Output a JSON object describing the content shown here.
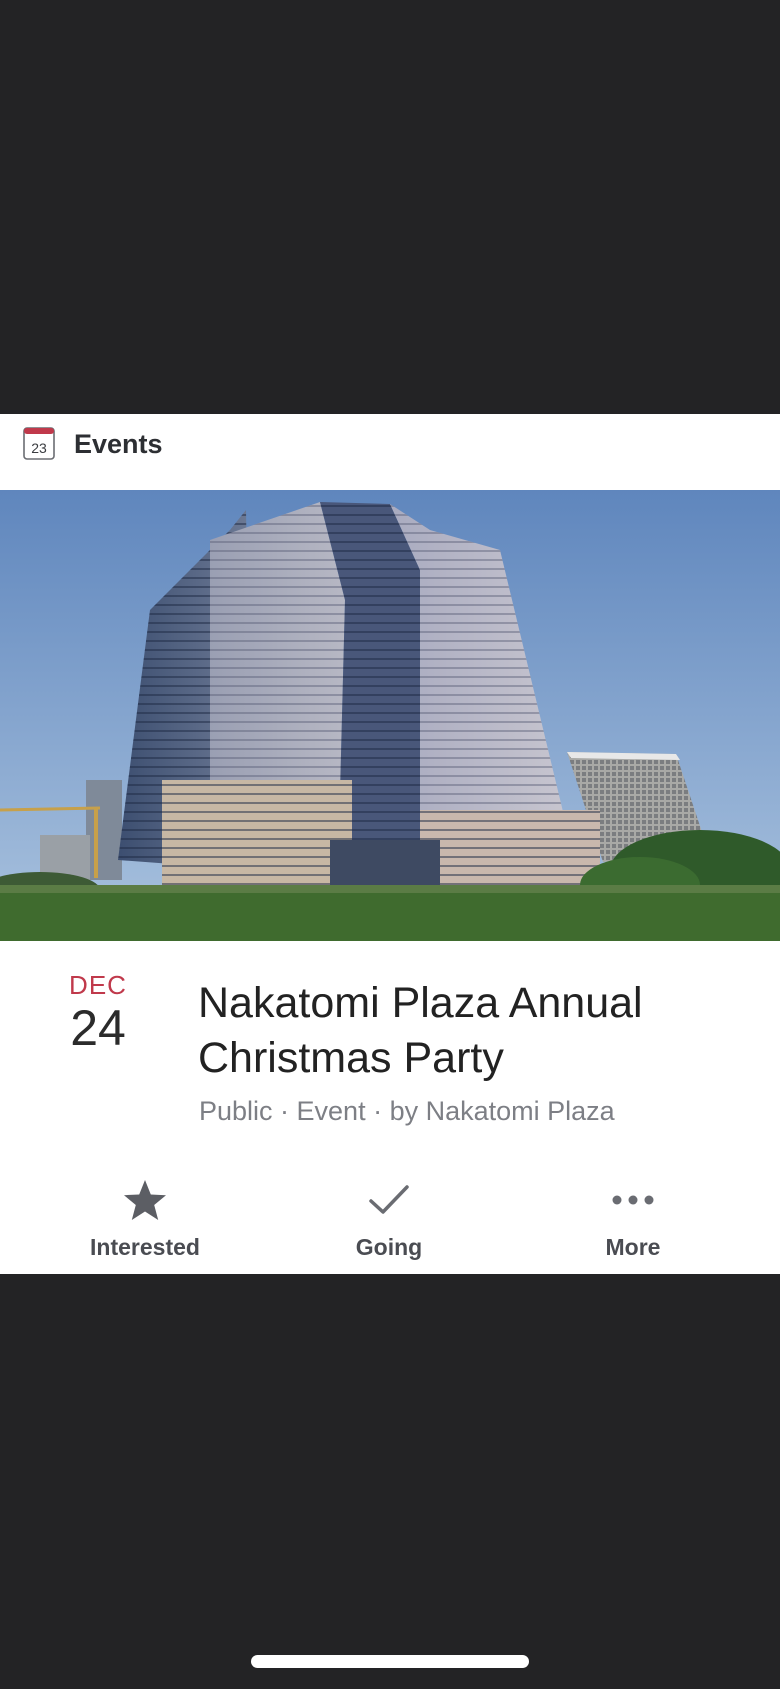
{
  "header": {
    "calendar_icon_number": "23",
    "title": "Events"
  },
  "event": {
    "month": "DEC",
    "day": "24",
    "title": "Nakatomi Plaza Annual Christmas Party",
    "meta": "Public · Event · by Nakatomi Plaza",
    "photo_icon": "building-photo"
  },
  "actions": [
    {
      "label": "Interested",
      "icon": "star-icon"
    },
    {
      "label": "Going",
      "icon": "checkmark-icon"
    },
    {
      "label": "More",
      "icon": "more-dots-icon"
    }
  ],
  "colors": {
    "background": "#232325",
    "card": "#ffffff",
    "month_accent": "#c0394b",
    "action_gray": "#4a4c52"
  }
}
